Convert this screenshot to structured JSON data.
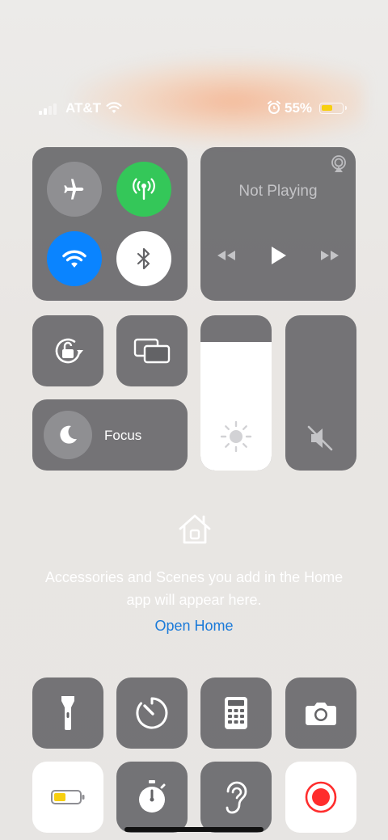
{
  "status_bar": {
    "carrier": "AT&T",
    "battery_percent": "55%",
    "battery_level": 0.55,
    "signal_bars": 2
  },
  "connectivity": {
    "airplane": "off",
    "cellular": "on",
    "wifi": "on",
    "bluetooth": "on"
  },
  "now_playing": {
    "title": "Not Playing"
  },
  "focus": {
    "label": "Focus"
  },
  "sliders": {
    "brightness_level": 0.83,
    "volume_level": 0.0
  },
  "home": {
    "message": "Accessories and Scenes you add in the Home app will appear here.",
    "link": "Open Home"
  },
  "colors": {
    "accent_green": "#34c759",
    "accent_blue": "#0a84ff",
    "link_blue": "#1a7ad9",
    "record_red": "#ff2d2d",
    "battery_yellow": "#f7cf0f"
  },
  "controls": [
    "flashlight-icon",
    "timer-icon",
    "calculator-icon",
    "camera-icon",
    "low-power-mode-icon",
    "stopwatch-icon",
    "hearing-icon",
    "screen-recording-icon"
  ]
}
